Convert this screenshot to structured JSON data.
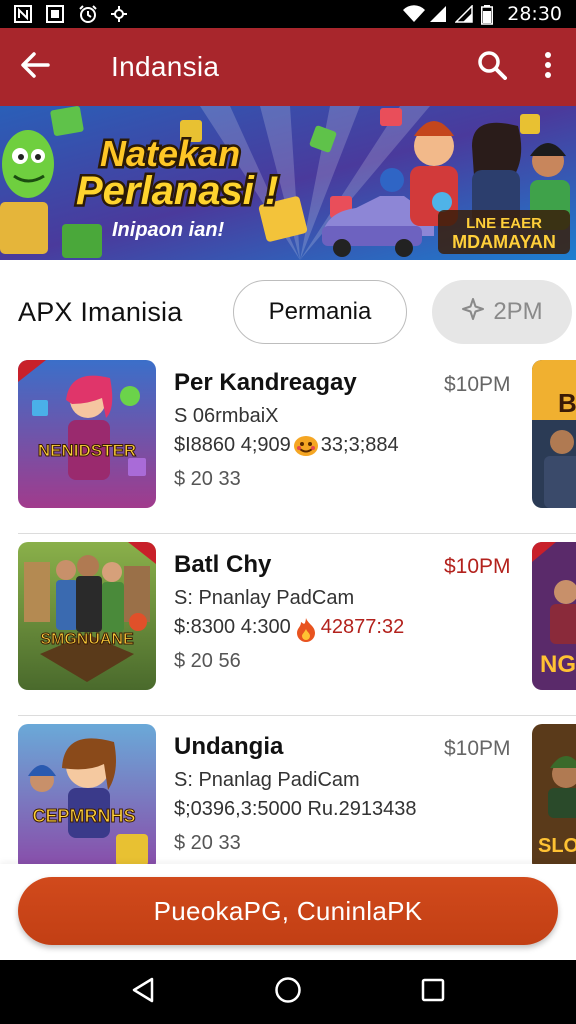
{
  "status_bar": {
    "time": "28:30",
    "left_icons": [
      "notification-n-icon",
      "screenshot-icon",
      "alarm-icon",
      "sync-icon"
    ],
    "right_icons": [
      "wifi-icon",
      "signal-icon",
      "signal-icon",
      "battery-icon"
    ]
  },
  "app_bar": {
    "title": "Indansia",
    "back_icon": "arrow-left-icon",
    "actions": [
      "search-icon",
      "more-vertical-icon"
    ]
  },
  "banner": {
    "headline_line1": "Natekan",
    "headline_line2": "Perlanasi !",
    "subline": "Inipaon ian!",
    "badge_line1": "LNE  EAER",
    "badge_line2": "MDAMAYAN"
  },
  "section": {
    "title": "APX Imanisia",
    "chip_primary": "Permania",
    "chip_secondary": "2PM",
    "chip_secondary_icon": "sparkle-icon"
  },
  "games": [
    {
      "title": "Per Kandreagay",
      "time": "$10PM",
      "time_highlight": false,
      "subtitle": "S 06rmbaiX",
      "stats_a": "$I8860 4;909",
      "stats_b": "33;3;884",
      "stats_icon": "emoji-icon",
      "price": "$ 20 33",
      "thumb_label": "NENIDSTER",
      "colors": {
        "thumb_bg": "#3b6fc9",
        "accent": "#e0a400"
      }
    },
    {
      "title": "Batl Chy",
      "time": "$10PM",
      "time_highlight": true,
      "subtitle": "S: Pnanlay PadCam",
      "stats_a": "$:8300 4:300",
      "stats_b": "42877:32",
      "stats_icon": "flame-icon",
      "price": "$ 20 56",
      "thumb_label": "SMGNUANE",
      "colors": {
        "thumb_bg": "#5a8a3c",
        "accent": "#d8a020"
      }
    },
    {
      "title": "Undangia",
      "time": "$10PM",
      "time_highlight": false,
      "subtitle": "S: Pnanlag PadiCam",
      "stats_a": "$;0396,3:5000 Ru.2913438",
      "stats_b": "",
      "stats_icon": "",
      "price": "$ 20 33",
      "thumb_label": "CEPMRNHS",
      "colors": {
        "thumb_bg": "#6aa9d8",
        "accent": "#e4b020"
      }
    }
  ],
  "side_thumbs": [
    "B",
    "NG",
    "SLOP"
  ],
  "cta": {
    "label": "PueokaPG, CuninlaPK"
  },
  "nav": [
    "back-triangle-icon",
    "home-circle-icon",
    "recents-square-icon"
  ],
  "theme": {
    "app_bar": "#a8262c",
    "cta": "#c94518",
    "accent_red": "#b3221d"
  }
}
